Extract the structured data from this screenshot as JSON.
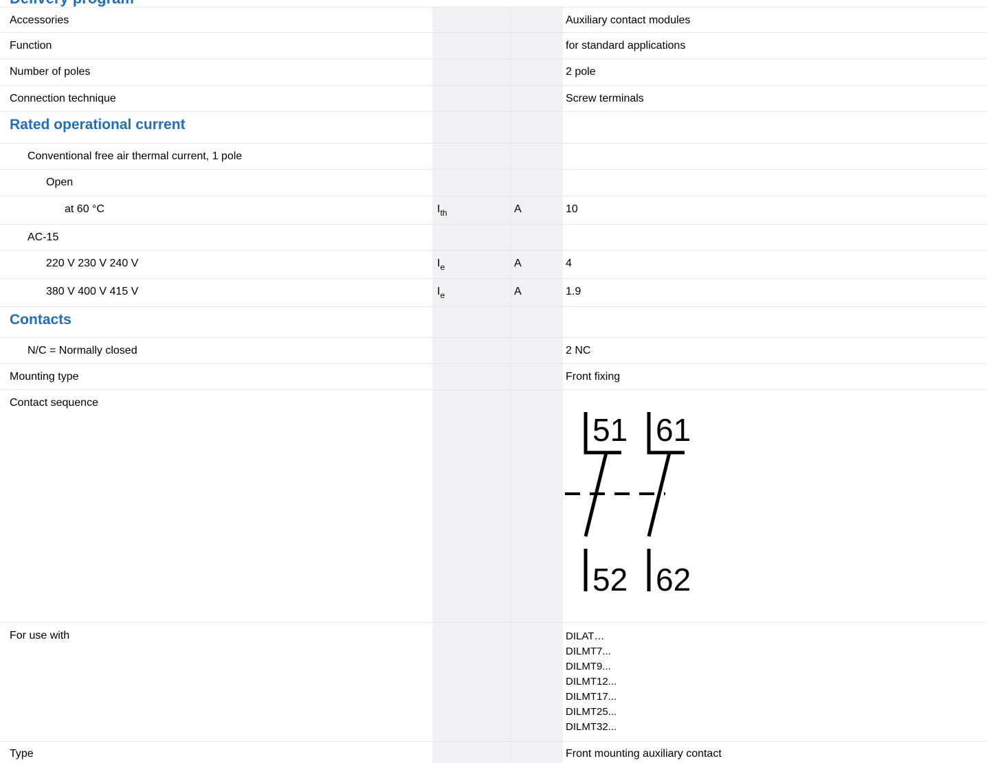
{
  "heading": "Delivery program",
  "rows": {
    "accessories": {
      "label": "Accessories",
      "value": "Auxiliary contact modules"
    },
    "function": {
      "label": "Function",
      "value": "for standard applications"
    },
    "poles": {
      "label": "Number of poles",
      "value": "2 pole"
    },
    "connection": {
      "label": "Connection technique",
      "value": "Screw terminals"
    },
    "rated_current": {
      "title": "Rated operational current"
    },
    "thermal": {
      "label": "Conventional free air thermal current, 1 pole"
    },
    "open": {
      "label": "Open"
    },
    "at60": {
      "label": "at 60 °C",
      "symbol": "I",
      "symbol_sub": "th",
      "unit": "A",
      "value": "10"
    },
    "ac15": {
      "label": "AC-15"
    },
    "v220": {
      "label": "220 V 230 V 240 V",
      "symbol": "I",
      "symbol_sub": "e",
      "unit": "A",
      "value": "4"
    },
    "v380": {
      "label": "380 V 400 V 415 V",
      "symbol": "I",
      "symbol_sub": "e",
      "unit": "A",
      "value": "1.9"
    },
    "contacts": {
      "title": "Contacts"
    },
    "nc": {
      "label": "N/C = Normally closed",
      "value": "2 NC"
    },
    "mounting": {
      "label": "Mounting type",
      "value": "Front fixing"
    },
    "sequence": {
      "label": "Contact sequence",
      "diagram": {
        "top_left": "51",
        "top_right": "61",
        "bottom_left": "52",
        "bottom_right": "62"
      }
    },
    "use_with": {
      "label": "For use with",
      "values": [
        "DILAT…",
        "DILMT7...",
        "DILMT9...",
        "DILMT12...",
        "DILMT17...",
        "DILMT25...",
        "DILMT32..."
      ]
    },
    "type": {
      "label": "Type",
      "value": "Front mounting auxiliary contact"
    }
  },
  "colors": {
    "heading": "#1f6fc1",
    "column_shade": "#eff1f5",
    "rule": "#e4e6eb"
  }
}
